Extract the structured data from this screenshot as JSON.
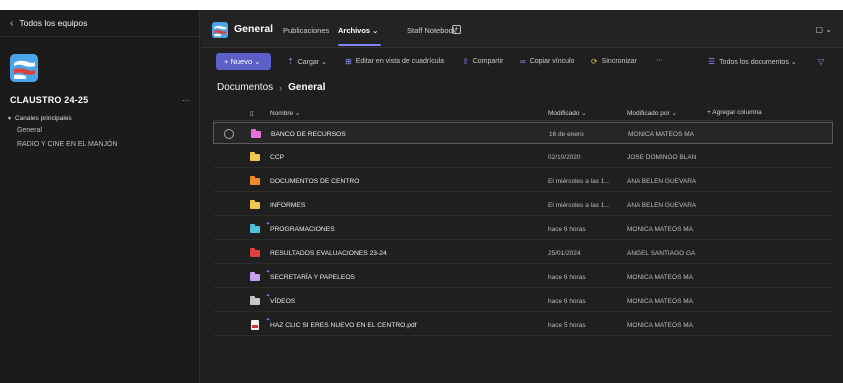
{
  "sidebar": {
    "back_label": "Todos los equipos",
    "team_name": "CLAUSTRO 24-25",
    "more": "···",
    "channels_header": "Canales principales",
    "channels": [
      "General",
      "RADIO Y CINE EN EL MANJÓN"
    ]
  },
  "header": {
    "channel_title": "General",
    "tabs": [
      "Publicaciones",
      "Archivos ⌄",
      "Staff Notebook"
    ],
    "right": "▢ ⌄"
  },
  "toolbar": {
    "new_label": "+ Nuevo ⌄",
    "upload": "Cargar ⌄",
    "grid_edit": "Editar en vista de cuadrícula",
    "share": "Compartir",
    "copy_link": "Copiar vínculo",
    "sync": "Sincronizar",
    "more": "···",
    "view": "Todos los documentos ⌄"
  },
  "breadcrumb": {
    "root": "Documentos",
    "current": "General"
  },
  "table": {
    "columns": {
      "name": "Nombre ⌄",
      "modified": "Modificado ⌄",
      "modified_by": "Modificado por ⌄",
      "add_column": "+ Agregar columna"
    },
    "rows": [
      {
        "name": "BANCO DE RECURSOS",
        "modified": "16 de enero",
        "by": "MONICA MATEOS MA",
        "color": "#e373d9",
        "type": "folder"
      },
      {
        "name": "CCP",
        "modified": "02/10/2020",
        "by": "JOSE DOMINGO BLAN",
        "color": "#f2c94c",
        "type": "folder"
      },
      {
        "name": "DOCUMENTOS DE CENTRO",
        "modified": "El miércoles a las 1...",
        "by": "ANA BELEN GUEVARA",
        "color": "#f08a24",
        "type": "folder"
      },
      {
        "name": "INFORMES",
        "modified": "El miércoles a las 1...",
        "by": "ANA BELEN GUEVARA",
        "color": "#f2c94c",
        "type": "folder"
      },
      {
        "name": "PROGRAMACIONES",
        "modified": "hace 6 horas",
        "by": "MONICA MATEOS MA",
        "color": "#4fc3d9",
        "type": "folder"
      },
      {
        "name": "RESULTADOS EVALUACIONES 23-24",
        "modified": "25/01/2024",
        "by": "ANGEL SANTIAGO GA",
        "color": "#e0423b",
        "type": "folder"
      },
      {
        "name": "SECRETARÍA Y PAPELEOS",
        "modified": "hace 6 horas",
        "by": "MONICA MATEOS MA",
        "color": "#c9a0f0",
        "type": "folder"
      },
      {
        "name": "VÍDEOS",
        "modified": "hace 6 horas",
        "by": "MONICA MATEOS MA",
        "color": "#c8c8c8",
        "type": "folder"
      },
      {
        "name": "HAZ CLIC SI ERES NUEVO EN EL CENTRO.pdf",
        "modified": "hace 5 horas",
        "by": "MONICA MATEOS MA",
        "color": "#d13438",
        "type": "pdf"
      }
    ]
  }
}
